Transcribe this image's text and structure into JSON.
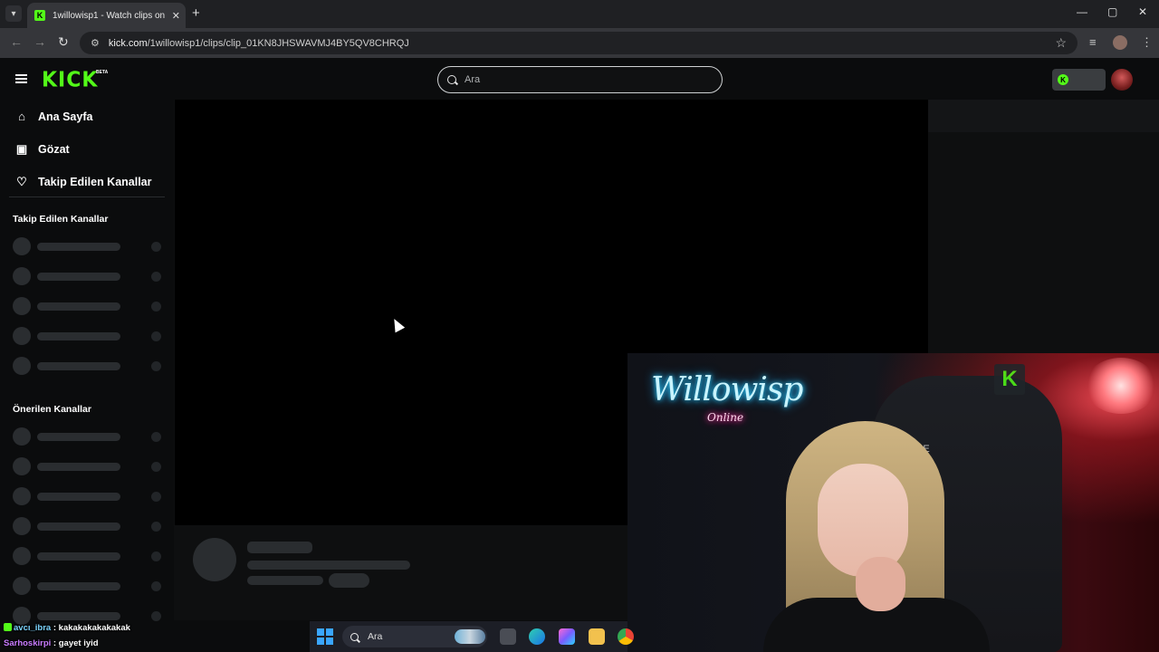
{
  "browser": {
    "tab_title": "1willowisp1 - Watch clips on Kick",
    "tab_close": "✕",
    "new_tab": "+",
    "url_host": "kick.com",
    "url_path": "/1willowisp1/clips/clip_01KN8JHSWAVMJ4BY5QV8CHRQJ",
    "window_controls": {
      "minimize": "—",
      "maximize": "▢",
      "close": "✕"
    }
  },
  "header": {
    "logo_text": "KICK",
    "logo_badge": "BETA",
    "search_placeholder": "Ara"
  },
  "sidebar": {
    "nav_items": [
      {
        "label": "Ana Sayfa",
        "icon": "home-icon"
      },
      {
        "label": "Gözat",
        "icon": "browse-icon"
      },
      {
        "label": "Takip Edilen Kanallar",
        "icon": "heart-icon"
      }
    ],
    "sections": {
      "followed": "Takip Edilen Kanallar",
      "recommended": "Önerilen Kanallar"
    }
  },
  "webcam": {
    "neon_sign": "Willowisp",
    "neon_sub": "Online",
    "chair_brand": "VE",
    "logo": "K"
  },
  "chat": [
    {
      "user": "avcı_ibra",
      "message": "kakakakakakakak",
      "user_color": "#7cd4ff"
    },
    {
      "user": "Sarhoskirpi",
      "message": "gayet iyid",
      "user_color": "#c97cff"
    }
  ],
  "taskbar": {
    "search_text": "Ara"
  },
  "colors": {
    "brand_green": "#53fc18",
    "page_bg": "#0b0c0d",
    "skeleton": "#2a2d30"
  }
}
